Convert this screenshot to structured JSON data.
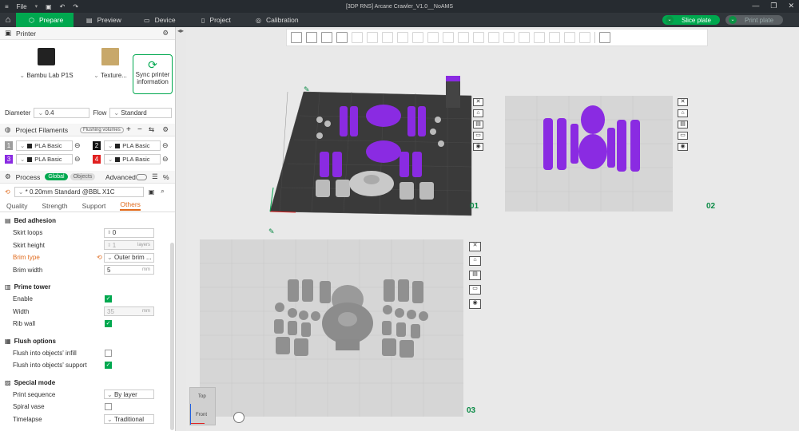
{
  "titlebar": {
    "file_menu": "File",
    "title": "[3DP RNS] Arcane Crawler_V1.0__NoAMS"
  },
  "tabs": [
    {
      "label": "Prepare",
      "active": true
    },
    {
      "label": "Preview"
    },
    {
      "label": "Device"
    },
    {
      "label": "Project"
    },
    {
      "label": "Calibration"
    }
  ],
  "actions": {
    "slice": "Slice plate",
    "print": "Print plate"
  },
  "printer": {
    "section": "Printer",
    "model": "Bambu Lab P1S",
    "plate_type": "Texture...",
    "sync_label": "Sync printer information",
    "diameter_label": "Diameter",
    "diameter": "0.4",
    "flow_label": "Flow",
    "flow": "Standard"
  },
  "filaments": {
    "section": "Project Filaments",
    "flushing": "Flushing volumes",
    "items": [
      {
        "num": "1",
        "color": "#9e9e9e",
        "name": "PLA Basic"
      },
      {
        "num": "2",
        "color": "#111111",
        "name": "PLA Basic"
      },
      {
        "num": "3",
        "color": "#8a2be2",
        "name": "PLA Basic"
      },
      {
        "num": "4",
        "color": "#e02020",
        "name": "PLA Basic"
      }
    ]
  },
  "process": {
    "section": "Process",
    "global": "Global",
    "objects": "Objects",
    "advanced": "Advanced",
    "profile": "* 0.20mm Standard @BBL X1C",
    "subtabs": [
      "Quality",
      "Strength",
      "Support",
      "Others"
    ],
    "active_subtab": "Others"
  },
  "groups": {
    "bed_adhesion": "Bed adhesion",
    "skirt_loops_label": "Skirt loops",
    "skirt_loops": "0",
    "skirt_height_label": "Skirt height",
    "skirt_height": "1",
    "skirt_height_unit": "layers",
    "brim_type_label": "Brim type",
    "brim_type": "Outer brim ...",
    "brim_width_label": "Brim width",
    "brim_width": "5",
    "mm": "mm",
    "prime_tower": "Prime tower",
    "enable_label": "Enable",
    "width_label": "Width",
    "width": "35",
    "rib_wall_label": "Rib wall",
    "flush_options": "Flush options",
    "flush_infill_label": "Flush into objects' infill",
    "flush_support_label": "Flush into objects' support",
    "special_mode": "Special mode",
    "print_sequence_label": "Print sequence",
    "print_sequence": "By layer",
    "spiral_vase_label": "Spiral vase",
    "timelapse_label": "Timelapse",
    "timelapse": "Traditional"
  },
  "plates": {
    "p1": "01",
    "p2": "02",
    "p3": "03"
  },
  "navcube": {
    "top": "Top",
    "front": "Front"
  },
  "colors": {
    "accent": "#00a84f",
    "purple": "#8a2be2",
    "brim_orange": "#e06a1c"
  }
}
